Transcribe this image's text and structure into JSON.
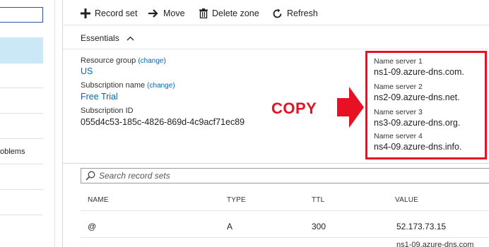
{
  "sidebar": {
    "problems_partial": "oblems"
  },
  "toolbar": {
    "record_set": "Record set",
    "move": "Move",
    "delete_zone": "Delete zone",
    "refresh": "Refresh"
  },
  "essentials": {
    "title": "Essentials",
    "change_label": "(change)",
    "resource_group_label": "Resource group",
    "resource_group_value": "US",
    "subscription_name_label": "Subscription name",
    "subscription_name_value": "Free Trial",
    "subscription_id_label": "Subscription ID",
    "subscription_id_value": "055d4c53-185c-4826-869d-4c9acf71ec89"
  },
  "name_servers": [
    {
      "label": "Name server 1",
      "value": "ns1-09.azure-dns.com."
    },
    {
      "label": "Name server 2",
      "value": "ns2-09.azure-dns.net."
    },
    {
      "label": "Name server 3",
      "value": "ns3-09.azure-dns.org."
    },
    {
      "label": "Name server 4",
      "value": "ns4-09.azure-dns.info."
    }
  ],
  "annotation": {
    "copy_text": "COPY",
    "color": "#e81123"
  },
  "search": {
    "placeholder": "Search record sets"
  },
  "table": {
    "columns": [
      "NAME",
      "TYPE",
      "TTL",
      "VALUE"
    ],
    "rows": [
      {
        "name": "@",
        "type": "A",
        "ttl": "300",
        "value": "52.173.73.15"
      }
    ],
    "next_row_value_partial": "ns1-09.azure-dns.com"
  },
  "colors": {
    "link": "#0067b8",
    "selected_bg": "#cbe8f6",
    "accent_red": "#e81123"
  }
}
